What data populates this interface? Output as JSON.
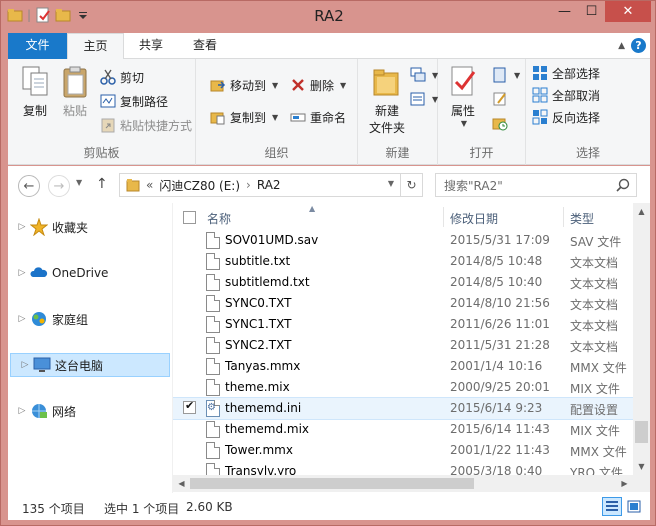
{
  "window": {
    "title": "RA2",
    "minimize": "—",
    "maximize": "☐",
    "close": "✕"
  },
  "ribbon_tabs": {
    "file": "文件",
    "home": "主页",
    "share": "共享",
    "view": "查看",
    "help": "?"
  },
  "clipboard": {
    "copy": "复制",
    "paste": "粘贴",
    "cut": "剪切",
    "copy_path": "复制路径",
    "paste_shortcut": "粘贴快捷方式",
    "group": "剪贴板"
  },
  "organize": {
    "move_to": "移动到",
    "delete": "删除",
    "copy_to": "复制到",
    "rename": "重命名",
    "group": "组织"
  },
  "new": {
    "new_folder_line1": "新建",
    "new_folder_line2": "文件夹",
    "group": "新建"
  },
  "open": {
    "properties": "属性",
    "group": "打开"
  },
  "select": {
    "select_all": "全部选择",
    "select_none": "全部取消",
    "invert": "反向选择",
    "group": "选择"
  },
  "address": {
    "crumb_sep": "«",
    "drive": "闪迪CZ80 (E:)",
    "folder": "RA2",
    "arrow": "›"
  },
  "search": {
    "placeholder": "搜索\"RA2\""
  },
  "nav": [
    "收藏夹",
    "OneDrive",
    "家庭组",
    "这台电脑",
    "网络"
  ],
  "columns": {
    "name": "名称",
    "date": "修改日期",
    "type": "类型"
  },
  "files": [
    {
      "name": "SOV01UMD.sav",
      "date": "2015/5/31 17:09",
      "type": "SAV 文件"
    },
    {
      "name": "subtitle.txt",
      "date": "2014/8/5 10:48",
      "type": "文本文档"
    },
    {
      "name": "subtitlemd.txt",
      "date": "2014/8/5 10:40",
      "type": "文本文档"
    },
    {
      "name": "SYNC0.TXT",
      "date": "2014/8/10 21:56",
      "type": "文本文档"
    },
    {
      "name": "SYNC1.TXT",
      "date": "2011/6/26 11:01",
      "type": "文本文档"
    },
    {
      "name": "SYNC2.TXT",
      "date": "2011/5/31 21:28",
      "type": "文本文档"
    },
    {
      "name": "Tanyas.mmx",
      "date": "2001/1/4 10:16",
      "type": "MMX 文件"
    },
    {
      "name": "theme.mix",
      "date": "2000/9/25 20:01",
      "type": "MIX 文件"
    },
    {
      "name": "thememd.ini",
      "date": "2015/6/14 9:23",
      "type": "配置设置"
    },
    {
      "name": "thememd.mix",
      "date": "2015/6/14 11:43",
      "type": "MIX 文件"
    },
    {
      "name": "Tower.mmx",
      "date": "2001/1/22 11:43",
      "type": "MMX 文件"
    },
    {
      "name": "Transylv.yro",
      "date": "2005/3/18 0:40",
      "type": "YRO 文件"
    }
  ],
  "status": {
    "count": "135 个项目",
    "selected": "选中 1 个项目",
    "size": "2.60 KB"
  },
  "colors": {
    "file_tab": "#1979ca",
    "title_bg": "#d8948e",
    "close_btn": "#c7504b",
    "selection": "#cce8ff",
    "folder": "#e8b84a"
  }
}
